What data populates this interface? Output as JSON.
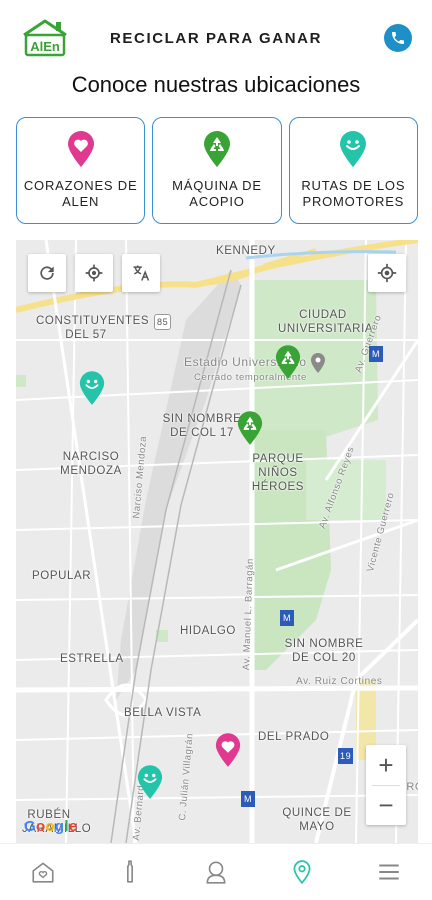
{
  "header": {
    "logo_text": "AlEn",
    "title": "RECICLAR PARA GANAR",
    "phone_icon": "phone-icon"
  },
  "subtitle": "Conoce nuestras ubicaciones",
  "categories": [
    {
      "label": "CORAZONES DE ALEN",
      "icon": "heart-pin-icon",
      "color": "#e0398f"
    },
    {
      "label": "MÁQUINA DE ACOPIO",
      "icon": "recycle-pin-icon",
      "color": "#3aa335"
    },
    {
      "label": "RUTAS DE LOS PROMOTORES",
      "icon": "smile-pin-icon",
      "color": "#23c4a9"
    }
  ],
  "map": {
    "labels": {
      "kennedy": "KENNEDY",
      "constituyentes": "CONSTITUYENTES DEL 57",
      "ciudad_universitaria": "CIUDAD UNIVERSITARIA",
      "estadio": "Estadio Universitario",
      "estadio_sub": "Cerrado temporalmente",
      "sin_nombre_17": "SIN NOMBRE DE COL 17",
      "parque": "PARQUE NIÑOS HÉROES",
      "narciso": "NARCISO MENDOZA",
      "popular": "POPULAR",
      "hidalgo": "HIDALGO",
      "sin_nombre_20": "SIN NOMBRE DE COL 20",
      "estrella": "ESTRELLA",
      "bella_vista": "BELLA VISTA",
      "del_prado": "DEL PRADO",
      "quince": "QUINCE DE MAYO",
      "ruben": "RUBÉN JARAMILLO",
      "centro": "CENTRO",
      "av_guerrero": "Av. Guerrero",
      "av_alfonso": "Av. Alfonso Reyes",
      "vicente": "Vicente Guerrero",
      "av_manuel": "Av. Manuel L. Barragán",
      "narciso_st": "Narciso Mendoza",
      "ruiz": "Av. Ruiz Cortines",
      "c_julian": "C. Julián Villagrán",
      "av_bernardo": "Av. Bernardo",
      "hwy_85": "85",
      "hwy_19": "19",
      "metro": "M"
    },
    "controls": {
      "refresh_icon": "refresh-icon",
      "locate_icon": "crosshair-icon",
      "translate_icon": "translate-icon",
      "my_location_icon": "my-location-icon",
      "zoom_in": "+",
      "zoom_out": "−"
    },
    "google_logo": "Google"
  },
  "bottom_nav": [
    {
      "name": "home",
      "icon": "home-icon"
    },
    {
      "name": "bottle",
      "icon": "bottle-icon"
    },
    {
      "name": "profile",
      "icon": "profile-icon"
    },
    {
      "name": "locations",
      "icon": "location-pin-icon",
      "active": true
    },
    {
      "name": "menu",
      "icon": "menu-icon"
    }
  ],
  "colors": {
    "accent_blue": "#1e90c8",
    "card_border": "#3a8fd0",
    "heart": "#e0398f",
    "recycle": "#3aa335",
    "smile": "#23c4a9",
    "nav_active": "#23c4a9"
  }
}
